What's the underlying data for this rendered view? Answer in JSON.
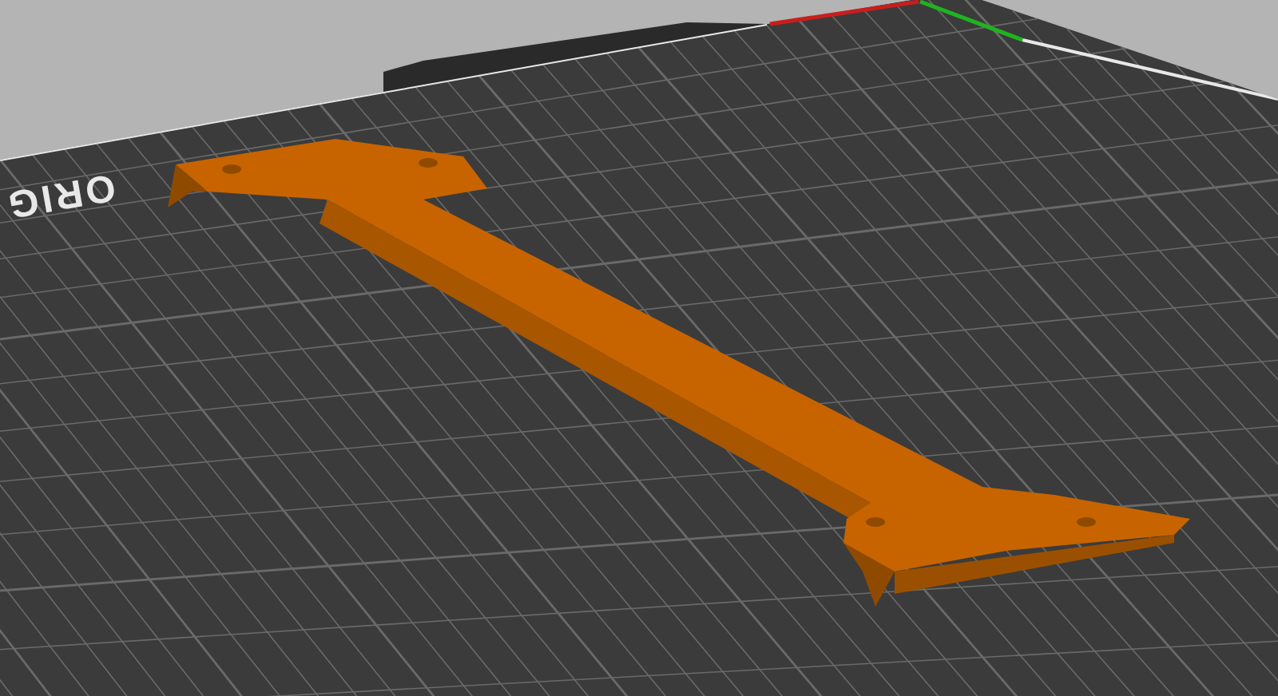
{
  "viewport": {
    "bed_label": "ORIG"
  }
}
